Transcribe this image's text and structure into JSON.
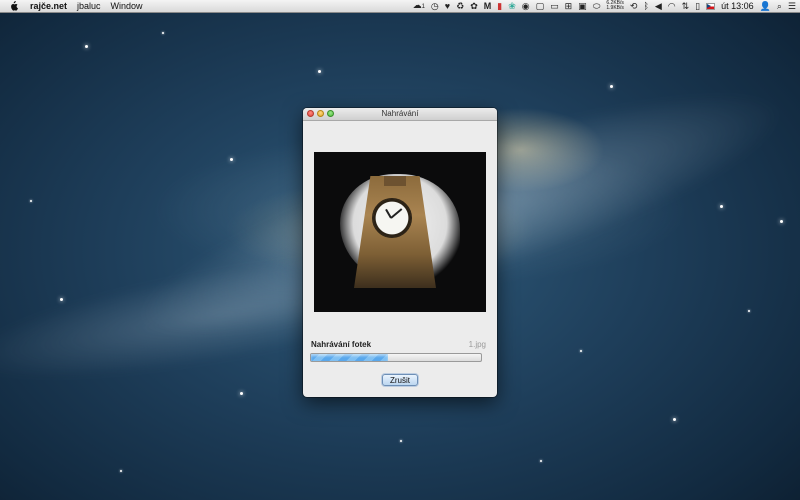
{
  "menubar": {
    "app_name": "rajče.net",
    "menus": [
      "jbaluc",
      "Window"
    ],
    "status_icons": [
      "cloud-icon",
      "clock-icon",
      "heart-icon",
      "recycle-icon",
      "paw-icon",
      "gmail-icon",
      "battery-stack-icon",
      "spiral-icon",
      "target-icon",
      "square-icon",
      "monitor-icon",
      "gamepad-icon",
      "display-icon",
      "oval-icon"
    ],
    "cloud_badge": "1",
    "net_up": "6.2KB/s",
    "net_down": "1.9KB/s",
    "clock": "út 13:06"
  },
  "window": {
    "title": "Nahrávání",
    "status_label": "Nahrávání fotek",
    "current_file": "1.jpg",
    "progress_fraction": 0.45,
    "cancel_label": "Zrušit"
  },
  "colors": {
    "progress_blue": "#5aa8ec",
    "button_border": "#6e8fb6"
  }
}
